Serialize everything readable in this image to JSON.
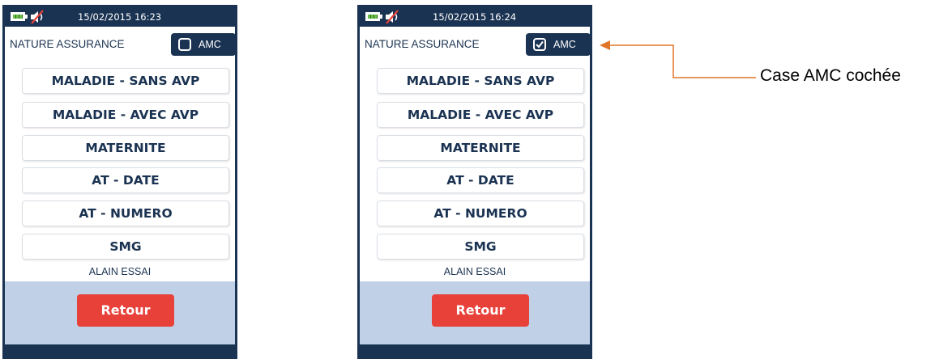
{
  "screens": {
    "left": {
      "status": {
        "datetime": "15/02/2015 16:23"
      },
      "header": {
        "label": "NATURE ASSURANCE",
        "amc_label": "AMC",
        "amc_checked": false
      },
      "menu": [
        "MALADIE - SANS AVP",
        "MALADIE - AVEC AVP",
        "MATERNITE",
        "AT - DATE",
        "AT - NUMERO",
        "SMG"
      ],
      "user_name": "ALAIN ESSAI",
      "back_label": "Retour"
    },
    "right": {
      "status": {
        "datetime": "15/02/2015 16:24"
      },
      "header": {
        "label": "NATURE ASSURANCE",
        "amc_label": "AMC",
        "amc_checked": true
      },
      "menu": [
        "MALADIE - SANS AVP",
        "MALADIE - AVEC AVP",
        "MATERNITE",
        "AT - DATE",
        "AT - NUMERO",
        "SMG"
      ],
      "user_name": "ALAIN ESSAI",
      "back_label": "Retour"
    }
  },
  "annotation": {
    "text": "Case AMC cochée",
    "color": "#e0762a"
  },
  "colors": {
    "navy": "#1b3352",
    "red": "#e8413a",
    "footer": "#c0d0e6"
  },
  "icons": {
    "battery": "battery-icon",
    "speaker": "speaker-muted-icon",
    "check": "check-icon"
  }
}
